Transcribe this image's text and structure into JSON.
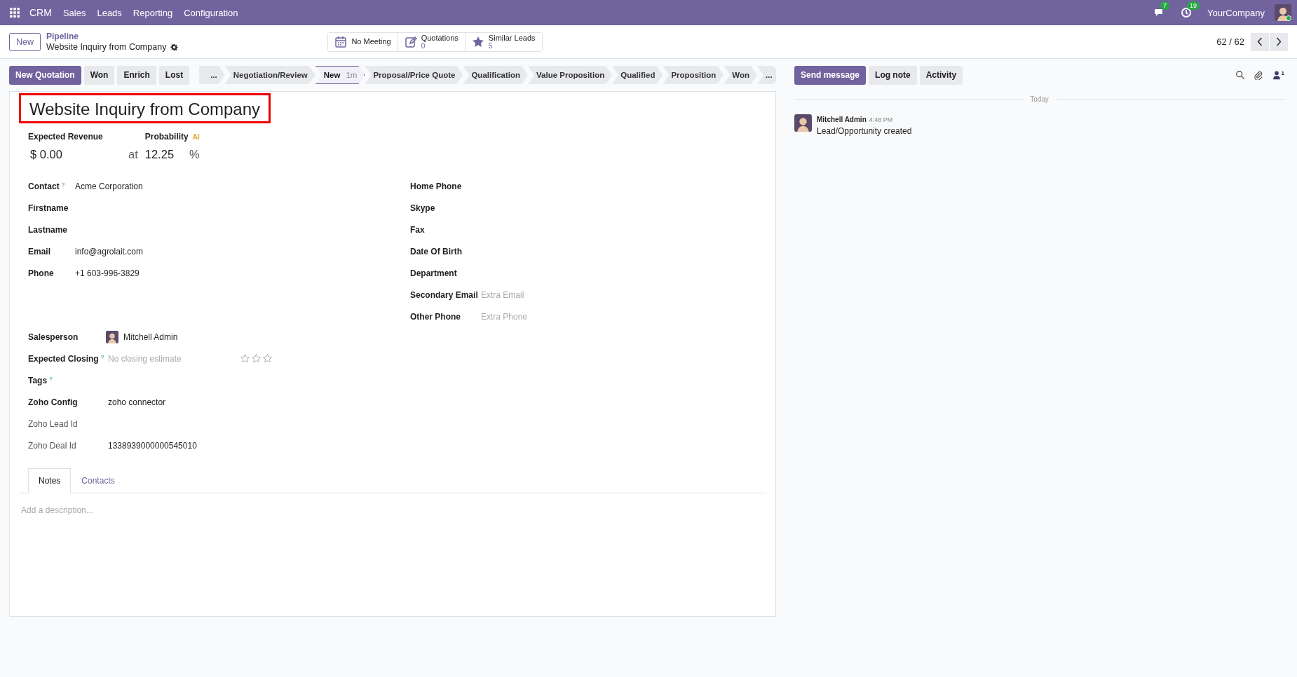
{
  "navbar": {
    "app": "CRM",
    "menu": [
      "Sales",
      "Leads",
      "Reporting",
      "Configuration"
    ],
    "messages_badge": "7",
    "activities_badge": "19",
    "company": "YourCompany"
  },
  "control_panel": {
    "new_button": "New",
    "breadcrumb": "Pipeline",
    "record": "Website Inquiry from Company",
    "smart_buttons": [
      {
        "kind": "calendar",
        "label": "No Meeting"
      },
      {
        "kind": "edit",
        "label": "Quotations",
        "count": "0"
      },
      {
        "kind": "star",
        "label": "Similar Leads",
        "count": "5"
      }
    ],
    "pager": "62 / 62"
  },
  "actions": [
    {
      "label": "New Quotation",
      "primary": true
    },
    {
      "label": "Won",
      "primary": false
    },
    {
      "label": "Enrich",
      "primary": false
    },
    {
      "label": "Lost",
      "primary": false
    }
  ],
  "stages": [
    {
      "label": "...",
      "selected": false
    },
    {
      "label": "Negotiation/Review",
      "selected": false
    },
    {
      "label": "New",
      "selected": true,
      "duration": "1m"
    },
    {
      "label": "Proposal/Price Quote",
      "selected": false
    },
    {
      "label": "Qualification",
      "selected": false
    },
    {
      "label": "Value Proposition",
      "selected": false
    },
    {
      "label": "Qualified",
      "selected": false
    },
    {
      "label": "Proposition",
      "selected": false
    },
    {
      "label": "Won",
      "selected": false
    },
    {
      "label": "...",
      "selected": false
    }
  ],
  "form": {
    "title": "Website Inquiry from  Company",
    "expected_revenue": {
      "label": "Expected Revenue",
      "value": "$ 0.00"
    },
    "at": "at",
    "probability": {
      "label": "Probability",
      "badge": "AI",
      "value": "12.25",
      "unit": "%"
    },
    "left_fields": [
      {
        "label": "Contact",
        "help": "?",
        "value": "Acme Corporation"
      },
      {
        "label": "Firstname"
      },
      {
        "label": "Lastname"
      },
      {
        "label": "Email",
        "value": "info@agrolait.com"
      },
      {
        "label": "Phone",
        "value": "+1 603-996-3829"
      }
    ],
    "right_fields": [
      {
        "label": "Home Phone"
      },
      {
        "label": "Skype"
      },
      {
        "label": "Fax"
      },
      {
        "label": "Date Of Birth"
      },
      {
        "label": "Department"
      },
      {
        "label": "Secondary Email",
        "placeholder": "Extra Email"
      },
      {
        "label": "Other Phone",
        "placeholder": "Extra Phone"
      }
    ],
    "lower_fields": [
      {
        "kind": "user",
        "label": "Salesperson",
        "value": "Mitchell Admin"
      },
      {
        "kind": "date",
        "label": "Expected Closing",
        "help": "?",
        "placeholder": "No closing estimate",
        "stars": 0
      },
      {
        "kind": "text",
        "label": "Tags",
        "help": "?"
      },
      {
        "kind": "text",
        "label": "Zoho Config",
        "value": "zoho connector"
      },
      {
        "kind": "text",
        "label": "Zoho Lead Id",
        "readonly": true
      },
      {
        "kind": "text",
        "label": "Zoho Deal Id",
        "readonly": true,
        "value": "1338939000000545010"
      }
    ],
    "tabs": [
      {
        "label": "Notes",
        "selected": true
      },
      {
        "label": "Contacts",
        "selected": false
      }
    ],
    "notes_placeholder": "Add a description..."
  },
  "chatter": {
    "buttons": [
      {
        "label": "Send message",
        "primary": true
      },
      {
        "label": "Log note",
        "primary": false
      },
      {
        "label": "Activity",
        "primary": false
      }
    ],
    "followers": "1",
    "divider": "Today",
    "messages": [
      {
        "author": "Mitchell Admin",
        "time": "4:48 PM",
        "body": "Lead/Opportunity created"
      }
    ]
  }
}
